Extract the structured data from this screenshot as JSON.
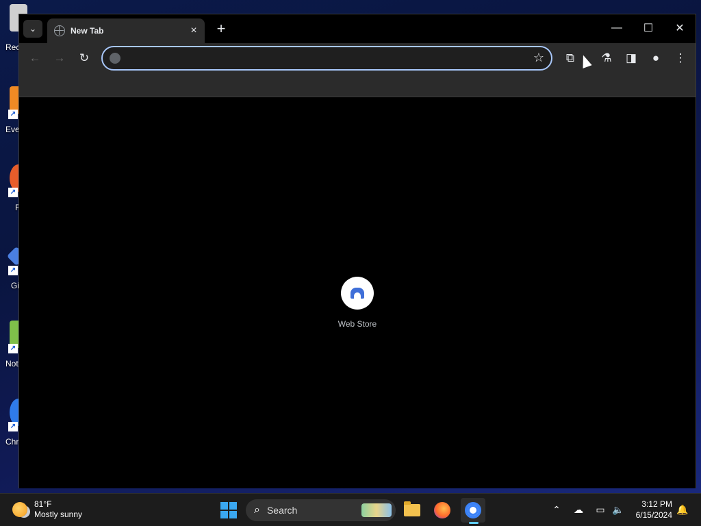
{
  "desktop": {
    "icons": [
      {
        "label": "Rec",
        "color": "#d9d9d9"
      },
      {
        "label": "Eve",
        "color": "#f08a24"
      },
      {
        "label": "F",
        "color": "#e85d2a"
      },
      {
        "label": "Gi",
        "color": "#4a7fe0"
      },
      {
        "label": "Not",
        "color": "#7fbf4a"
      },
      {
        "label": "Chr",
        "color": "#2f7bea"
      }
    ]
  },
  "browser": {
    "tab": {
      "title": "New Tab"
    },
    "omnibox": {
      "value": "",
      "placeholder": ""
    },
    "shortcut": {
      "label": "Web Store"
    },
    "controls": {
      "minimize": "—",
      "maximize": "☐",
      "close": "✕",
      "new_tab": "+"
    }
  },
  "taskbar": {
    "weather": {
      "temp": "81°F",
      "condition": "Mostly sunny"
    },
    "search": {
      "label": "Search"
    },
    "clock": {
      "time": "3:12 PM",
      "date": "6/15/2024"
    }
  },
  "colors": {
    "accent": "#a8c7fa",
    "tab_bg": "#2b2b2b",
    "taskbar_bg": "#1c1c1c"
  }
}
